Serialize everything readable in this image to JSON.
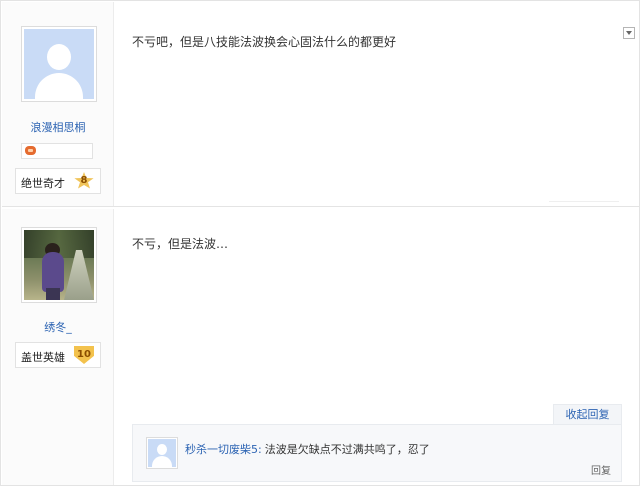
{
  "posts": [
    {
      "username": "浪漫相思桐",
      "title": "绝世奇才",
      "level": "8",
      "text": "不亏吧，但是八技能法波换会心固法什么的都更好"
    },
    {
      "username": "绣冬_",
      "title": "盖世英雄",
      "level": "10",
      "text": "不亏，但是法波…"
    }
  ],
  "reply_section": {
    "collapse_label": "收起回复",
    "reply": {
      "username": "秒杀一切废柴5:",
      "text": "法波是欠缺点不过满共鸣了，忍了",
      "action_label": "回复"
    }
  },
  "colors": {
    "link": "#2d64b3",
    "avatar_placeholder": "#c9dbf6",
    "level_badge": "#f0c45a"
  },
  "icons": {
    "post_menu": "chevron-down-icon",
    "game_badge": "gamepad-icon",
    "level_star": "star-icon",
    "level_shield": "shield-icon"
  }
}
